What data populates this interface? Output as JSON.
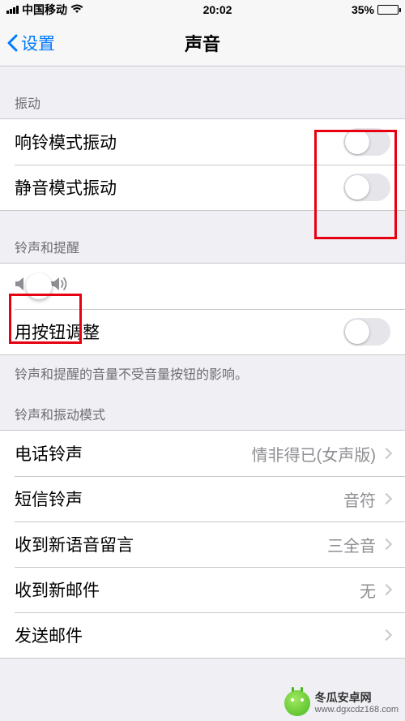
{
  "status": {
    "carrier": "中国移动",
    "time": "20:02",
    "battery_pct": "35%"
  },
  "nav": {
    "back_label": "设置",
    "title": "声音"
  },
  "sections": {
    "vibration_header": "振动",
    "ringer_header": "铃声和提醒",
    "ringer_footer": "铃声和提醒的音量不受音量按钮的影响。",
    "patterns_header": "铃声和振动模式"
  },
  "items": {
    "vibrate_ring": {
      "label": "响铃模式振动",
      "on": false
    },
    "vibrate_silent": {
      "label": "静音模式振动",
      "on": false
    },
    "change_with_buttons": {
      "label": "用按钮调整",
      "on": false
    },
    "ringtone": {
      "label": "电话铃声",
      "value": "情非得已(女声版)"
    },
    "text_tone": {
      "label": "短信铃声",
      "value": "音符"
    },
    "voicemail": {
      "label": "收到新语音留言",
      "value": "三全音"
    },
    "new_mail": {
      "label": "收到新邮件",
      "value": "无"
    },
    "sent_mail": {
      "label": "发送邮件",
      "value": ""
    }
  },
  "slider": {
    "value_pct": 6
  },
  "watermark": {
    "name": "冬瓜安卓网",
    "url": "www.dgxcdz168.com"
  }
}
